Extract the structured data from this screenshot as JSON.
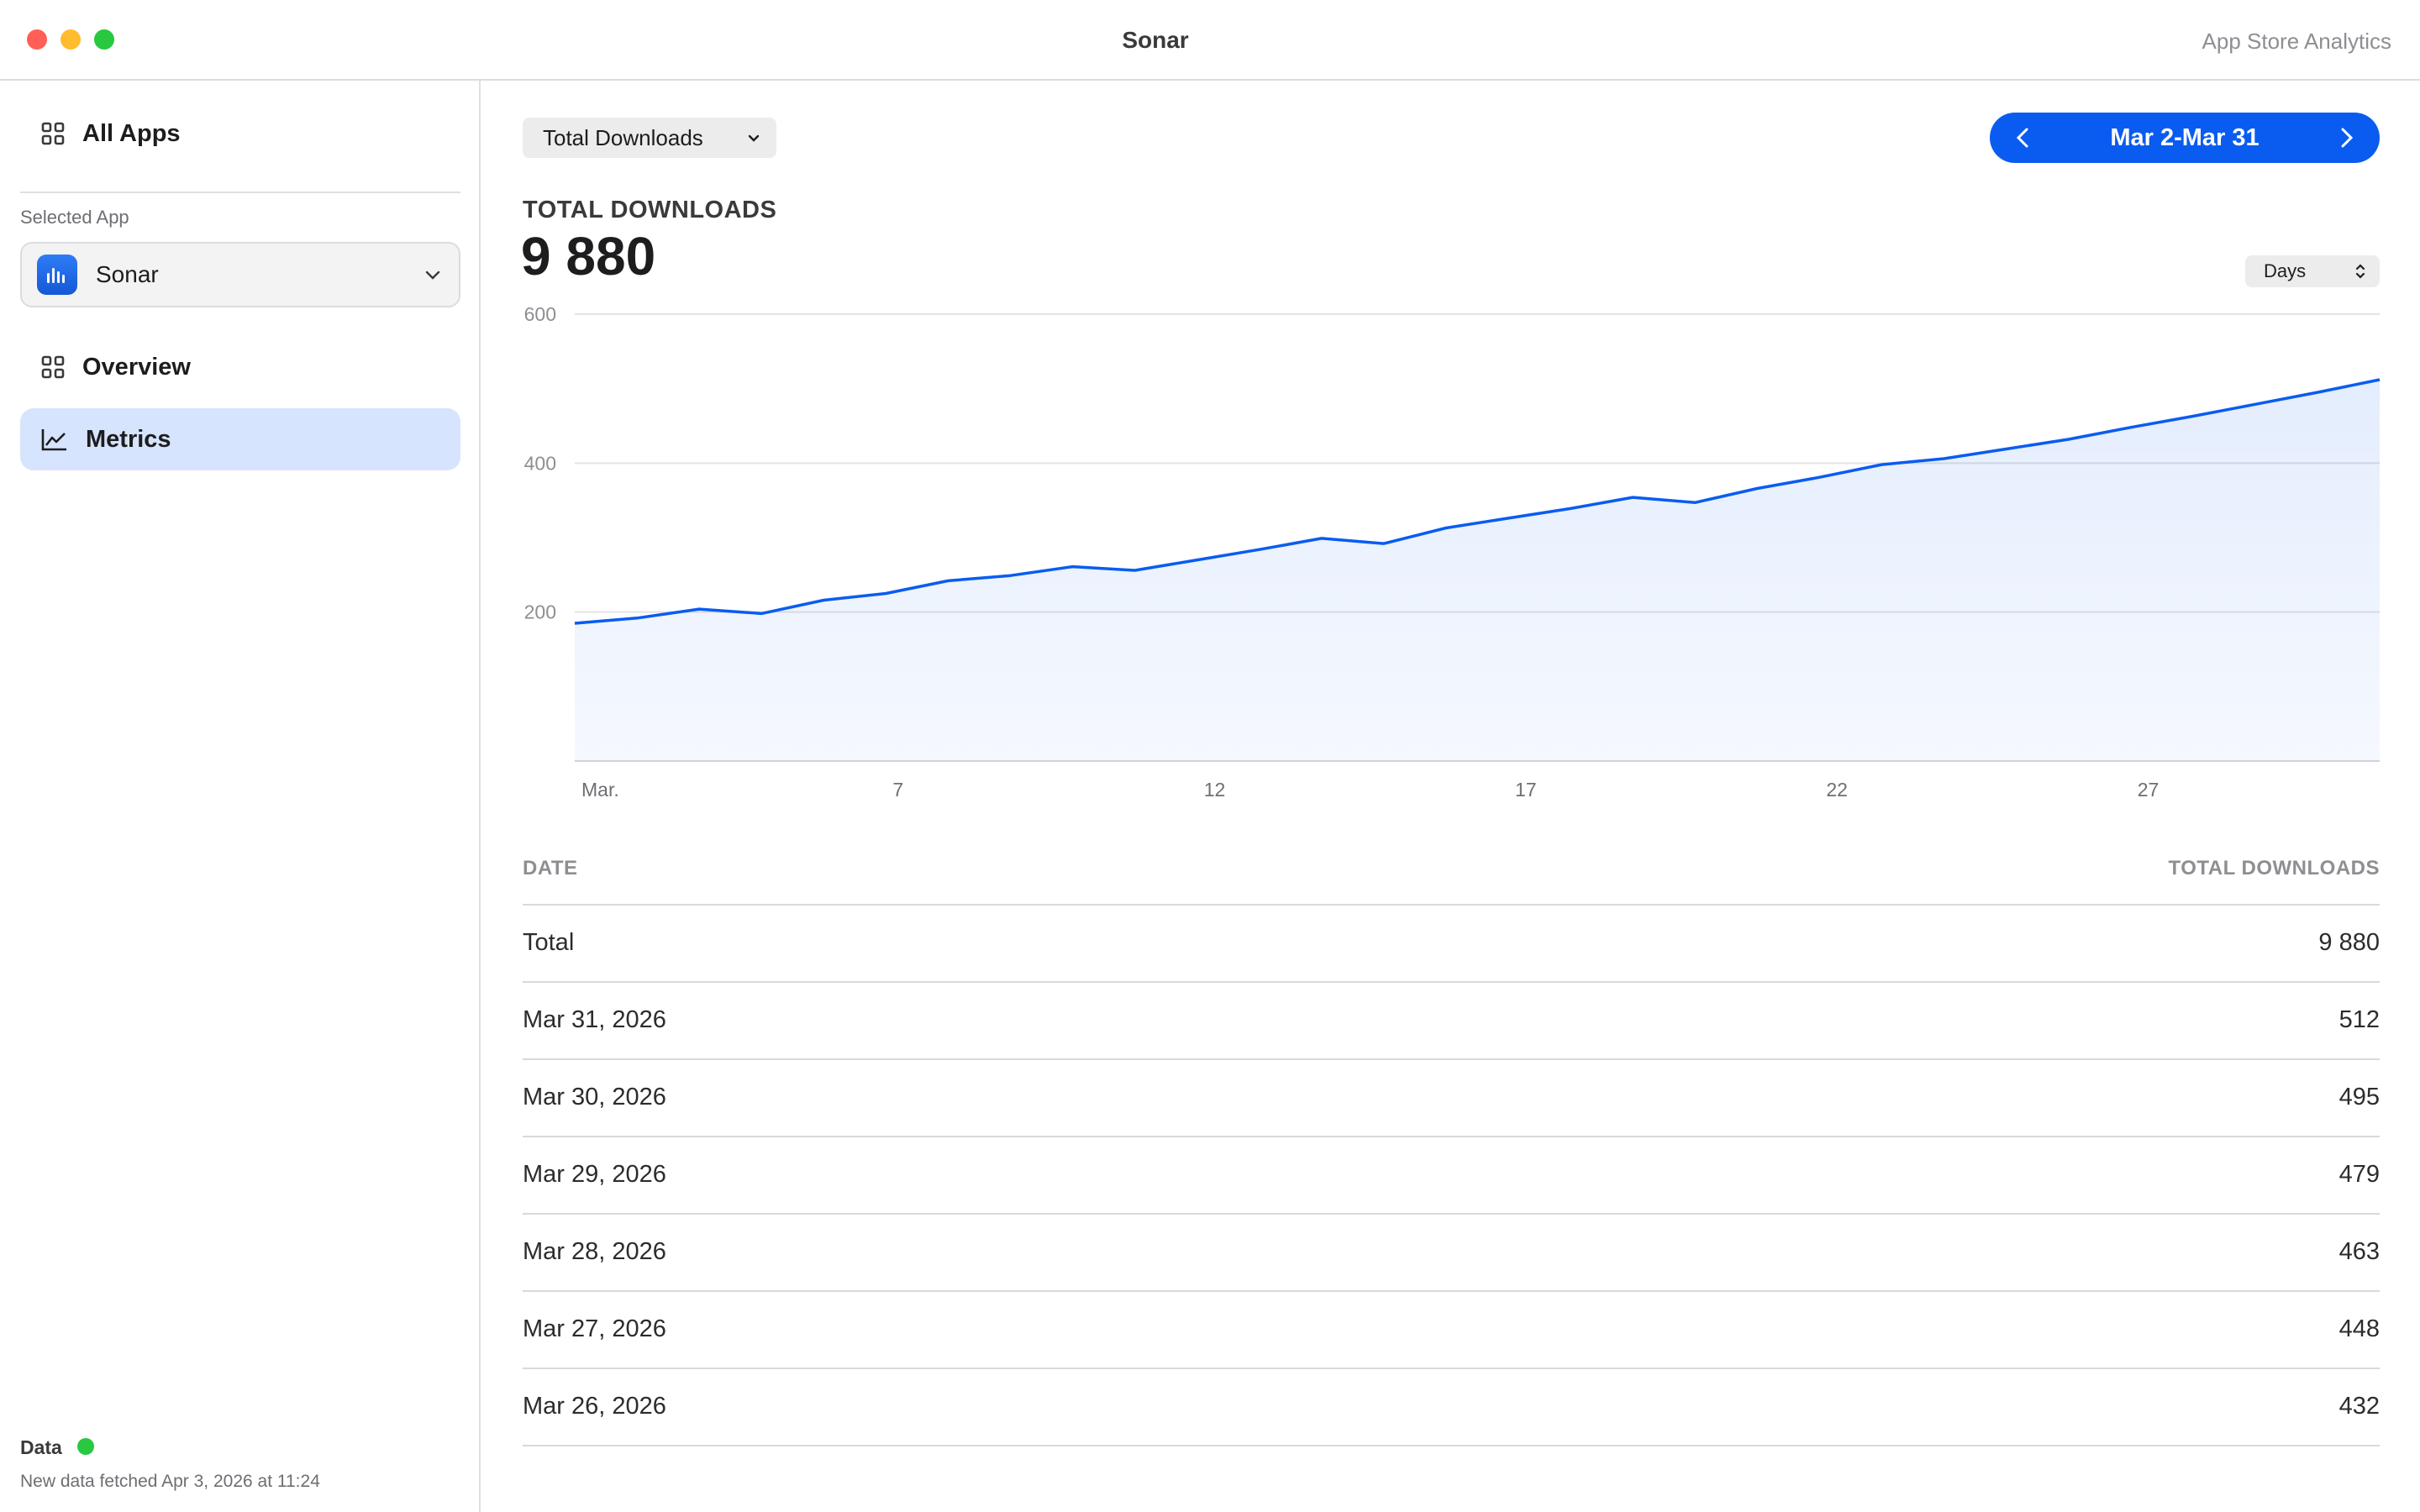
{
  "window": {
    "title": "Sonar",
    "subtitle": "App Store Analytics"
  },
  "sidebar": {
    "all_apps": "All Apps",
    "selected_app_label": "Selected App",
    "selected_app": "Sonar",
    "items": [
      {
        "label": "Overview",
        "active": false
      },
      {
        "label": "Metrics",
        "active": true
      }
    ],
    "status": {
      "title": "Data",
      "text": "New data fetched Apr 3, 2026 at 11:24",
      "color": "#28c840"
    }
  },
  "main": {
    "metric_select": "Total Downloads",
    "date_range": "Mar 2-Mar 31",
    "heading": "TOTAL DOWNLOADS",
    "total": "9 880",
    "period_select": "Days"
  },
  "chart_data": {
    "type": "area",
    "x": [
      2,
      3,
      4,
      5,
      6,
      7,
      8,
      9,
      10,
      11,
      12,
      13,
      14,
      15,
      16,
      17,
      18,
      19,
      20,
      21,
      22,
      23,
      24,
      25,
      26,
      27,
      28,
      29,
      30,
      31
    ],
    "values": [
      185,
      192,
      204,
      198,
      216,
      225,
      242,
      249,
      261,
      256,
      270,
      284,
      299,
      292,
      313,
      326,
      339,
      354,
      347,
      366,
      381,
      398,
      406,
      419,
      432,
      448,
      463,
      479,
      495,
      512
    ],
    "xticks": [
      {
        "x": 2,
        "label": "Mar."
      },
      {
        "x": 7,
        "label": "7"
      },
      {
        "x": 12,
        "label": "12"
      },
      {
        "x": 17,
        "label": "17"
      },
      {
        "x": 22,
        "label": "22"
      },
      {
        "x": 27,
        "label": "27"
      }
    ],
    "yticks": [
      200,
      400,
      600
    ],
    "ylim": [
      0,
      600
    ],
    "xlim": [
      2,
      31
    ],
    "grid": true,
    "line_color": "#0a5cf0"
  },
  "table": {
    "headers": [
      "DATE",
      "TOTAL DOWNLOADS"
    ],
    "rows": [
      [
        "Total",
        "9 880"
      ],
      [
        "Mar 31, 2026",
        "512"
      ],
      [
        "Mar 30, 2026",
        "495"
      ],
      [
        "Mar 29, 2026",
        "479"
      ],
      [
        "Mar 28, 2026",
        "463"
      ],
      [
        "Mar 27, 2026",
        "448"
      ],
      [
        "Mar 26, 2026",
        "432"
      ]
    ]
  },
  "colors": {
    "accent": "#0a5cf0",
    "active_bg": "#d6e4fd"
  }
}
